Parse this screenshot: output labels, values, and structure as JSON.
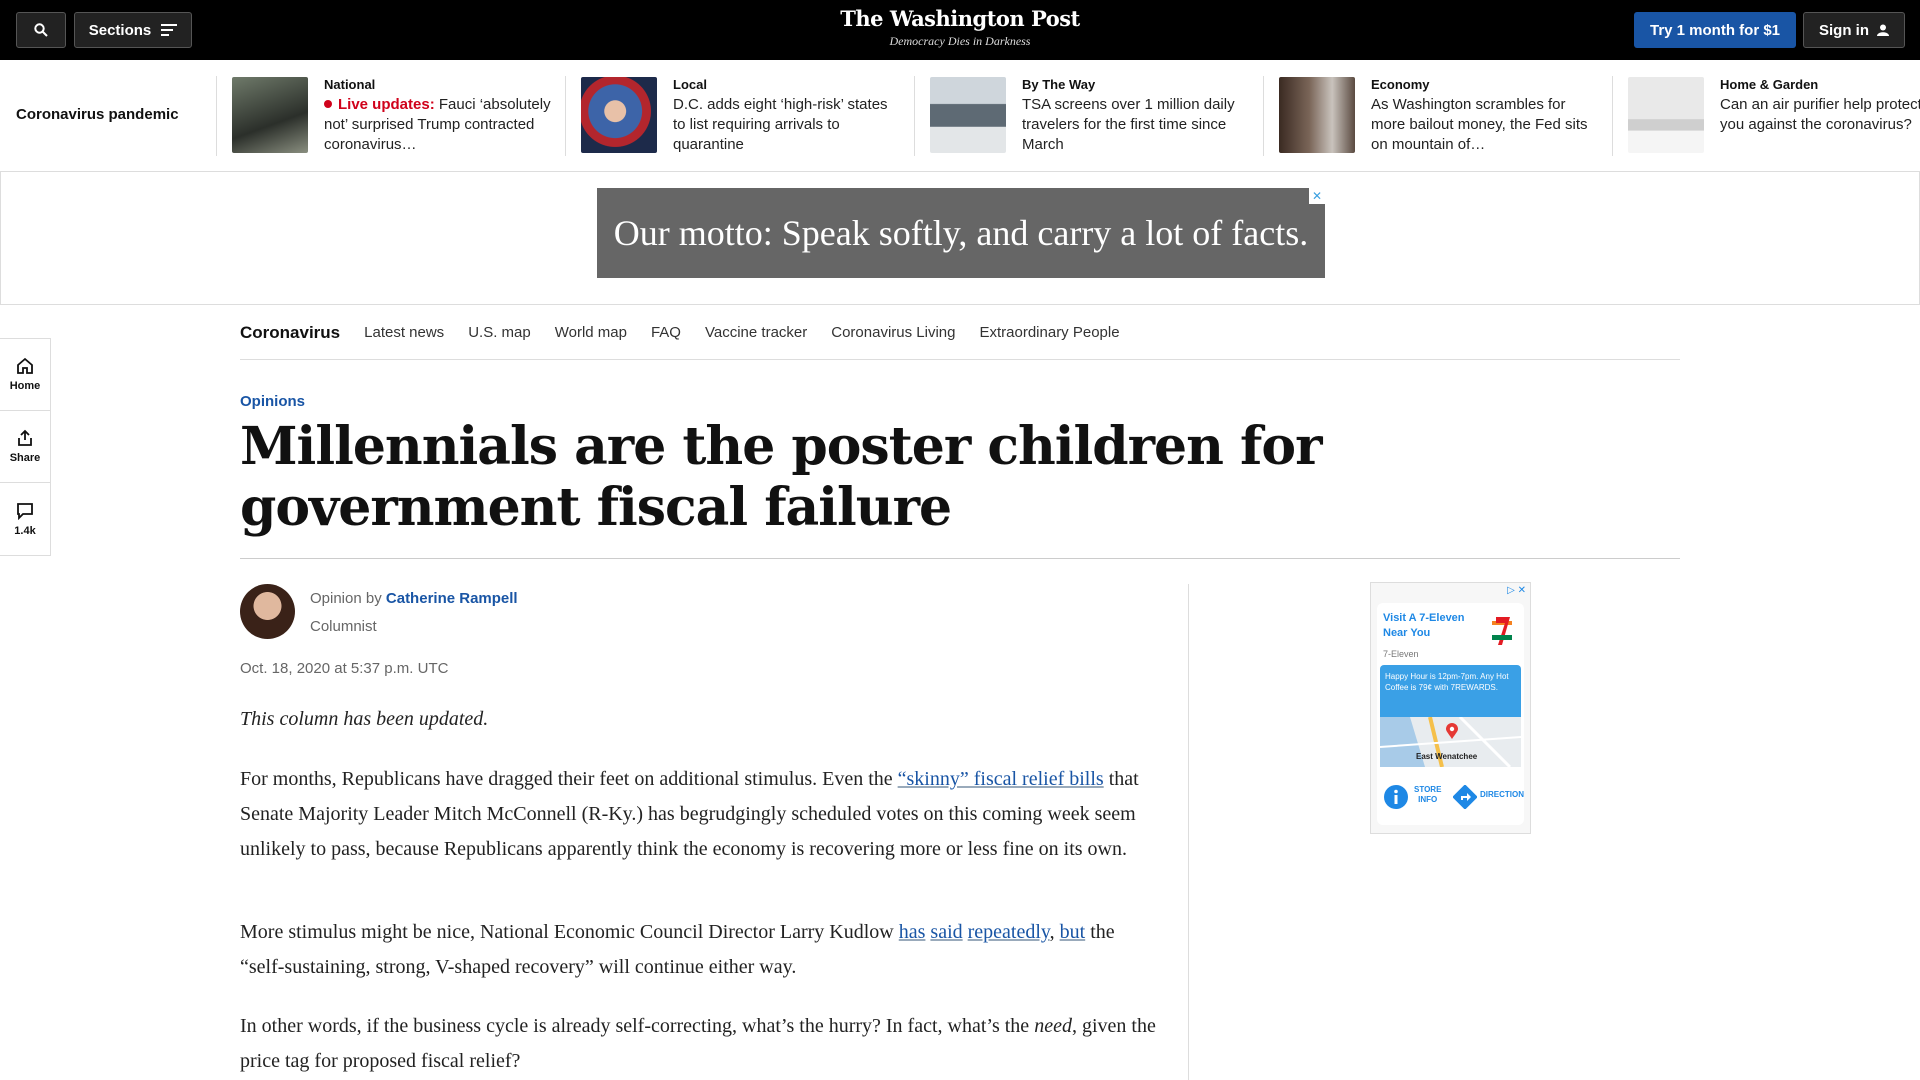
{
  "topbar": {
    "sections_label": "Sections",
    "logo": "The Washington Post",
    "tagline": "Democracy Dies in Darkness",
    "try_label": "Try 1 month for $1",
    "signin_label": "Sign in"
  },
  "strip": {
    "label": "Coronavirus pandemic",
    "cards": [
      {
        "kicker": "National",
        "live_label": "Live updates:",
        "headline": "Fauci ‘absolutely not’ surprised Trump contracted coronavirus…"
      },
      {
        "kicker": "Local",
        "headline": "D.C. adds eight ‘high-risk’ states to list requiring arrivals to quarantine"
      },
      {
        "kicker": "By The Way",
        "headline": "TSA screens over 1 million daily travelers for the first time since March"
      },
      {
        "kicker": "Economy",
        "headline": "As Washington scrambles for more bailout money, the Fed sits on mountain of…"
      },
      {
        "kicker": "Home & Garden",
        "headline": "Can an air purifier help protect you against the coronavirus?"
      }
    ]
  },
  "ad_banner": {
    "text": "Our motto: Speak softly, and carry a lot of facts."
  },
  "rail": {
    "home": "Home",
    "share": "Share",
    "comments": "1.4k"
  },
  "secnav": {
    "main": "Coronavirus",
    "items": [
      "Latest news",
      "U.S. map",
      "World map",
      "FAQ",
      "Vaccine tracker",
      "Coronavirus Living",
      "Extraordinary People"
    ]
  },
  "article": {
    "kicker": "Opinions",
    "headline": "Millennials are the poster children for government fiscal failure",
    "byline_prefix": "Opinion by",
    "author": "Catherine Rampell",
    "author_title": "Columnist",
    "date": "Oct. 18, 2020 at 5:37 p.m. UTC",
    "updated_note": "This column has been updated.",
    "p1_a": "For months, Republicans have dragged their feet on additional stimulus. Even the ",
    "p1_link": "“skinny” fiscal relief bills",
    "p1_b": " that Senate Majority Leader Mitch McConnell (R-Ky.) has begrudgingly scheduled votes on this coming week seem unlikely to pass, because Republicans apparently think the economy is recovering more or less fine on its own.",
    "p2_a": "More stimulus might be nice, National Economic Council Director Larry Kudlow ",
    "p2_link1": "has",
    "p2_link2": "said",
    "p2_link3": "repeatedly",
    "p2_comma": ", ",
    "p2_link4": "but",
    "p2_b": " the “self-sustaining, strong, V-shaped recovery” will continue either way.",
    "p3_a": "In other words, if the business cycle is already self-correcting, what’s the hurry? In fact, what’s the ",
    "p3_em": "need",
    "p3_b": ", given the price tag for proposed fiscal relief?"
  },
  "side_ad": {
    "title": "Visit A 7-Eleven Near You",
    "sub": "7-Eleven",
    "promo": "Happy Hour is 12pm-7pm. Any Hot Coffee is 79¢ with 7REWARDS.",
    "map_label": "East Wenatchee",
    "store_info": "STORE INFO",
    "directions": "DIRECTION"
  },
  "colors": {
    "brand_blue": "#1955a5",
    "live_red": "#d0021b",
    "topbar": "#000000"
  }
}
